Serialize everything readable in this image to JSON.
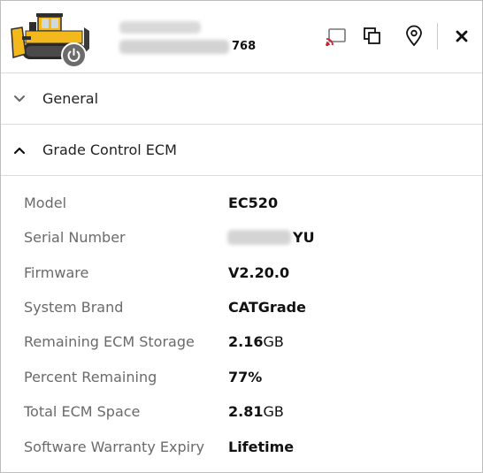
{
  "header": {
    "serial_suffix": "768"
  },
  "icons": {
    "cast": "cast-icon",
    "copy": "copy-icon",
    "location": "location-pin-icon",
    "close": "close-icon",
    "power": "power-icon",
    "machine": "bulldozer-icon",
    "cast_color": "#d21f2d"
  },
  "sections": {
    "general": {
      "title": "General",
      "expanded": false
    },
    "grade_control": {
      "title": "Grade Control ECM",
      "expanded": true
    }
  },
  "ecm": {
    "model": {
      "label": "Model",
      "value": "EC520"
    },
    "serial": {
      "label": "Serial Number",
      "suffix": "YU"
    },
    "firmware": {
      "label": "Firmware",
      "value": "V2.20.0"
    },
    "brand": {
      "label": "System Brand",
      "value": "CATGrade"
    },
    "remaining_storage": {
      "label": "Remaining ECM Storage",
      "value": "2.16",
      "unit": "GB"
    },
    "percent_remaining": {
      "label": "Percent Remaining",
      "value": "77%"
    },
    "total_space": {
      "label": "Total ECM Space",
      "value": "2.81",
      "unit": "GB"
    },
    "warranty": {
      "label": "Software Warranty Expiry",
      "value": "Lifetime"
    }
  }
}
